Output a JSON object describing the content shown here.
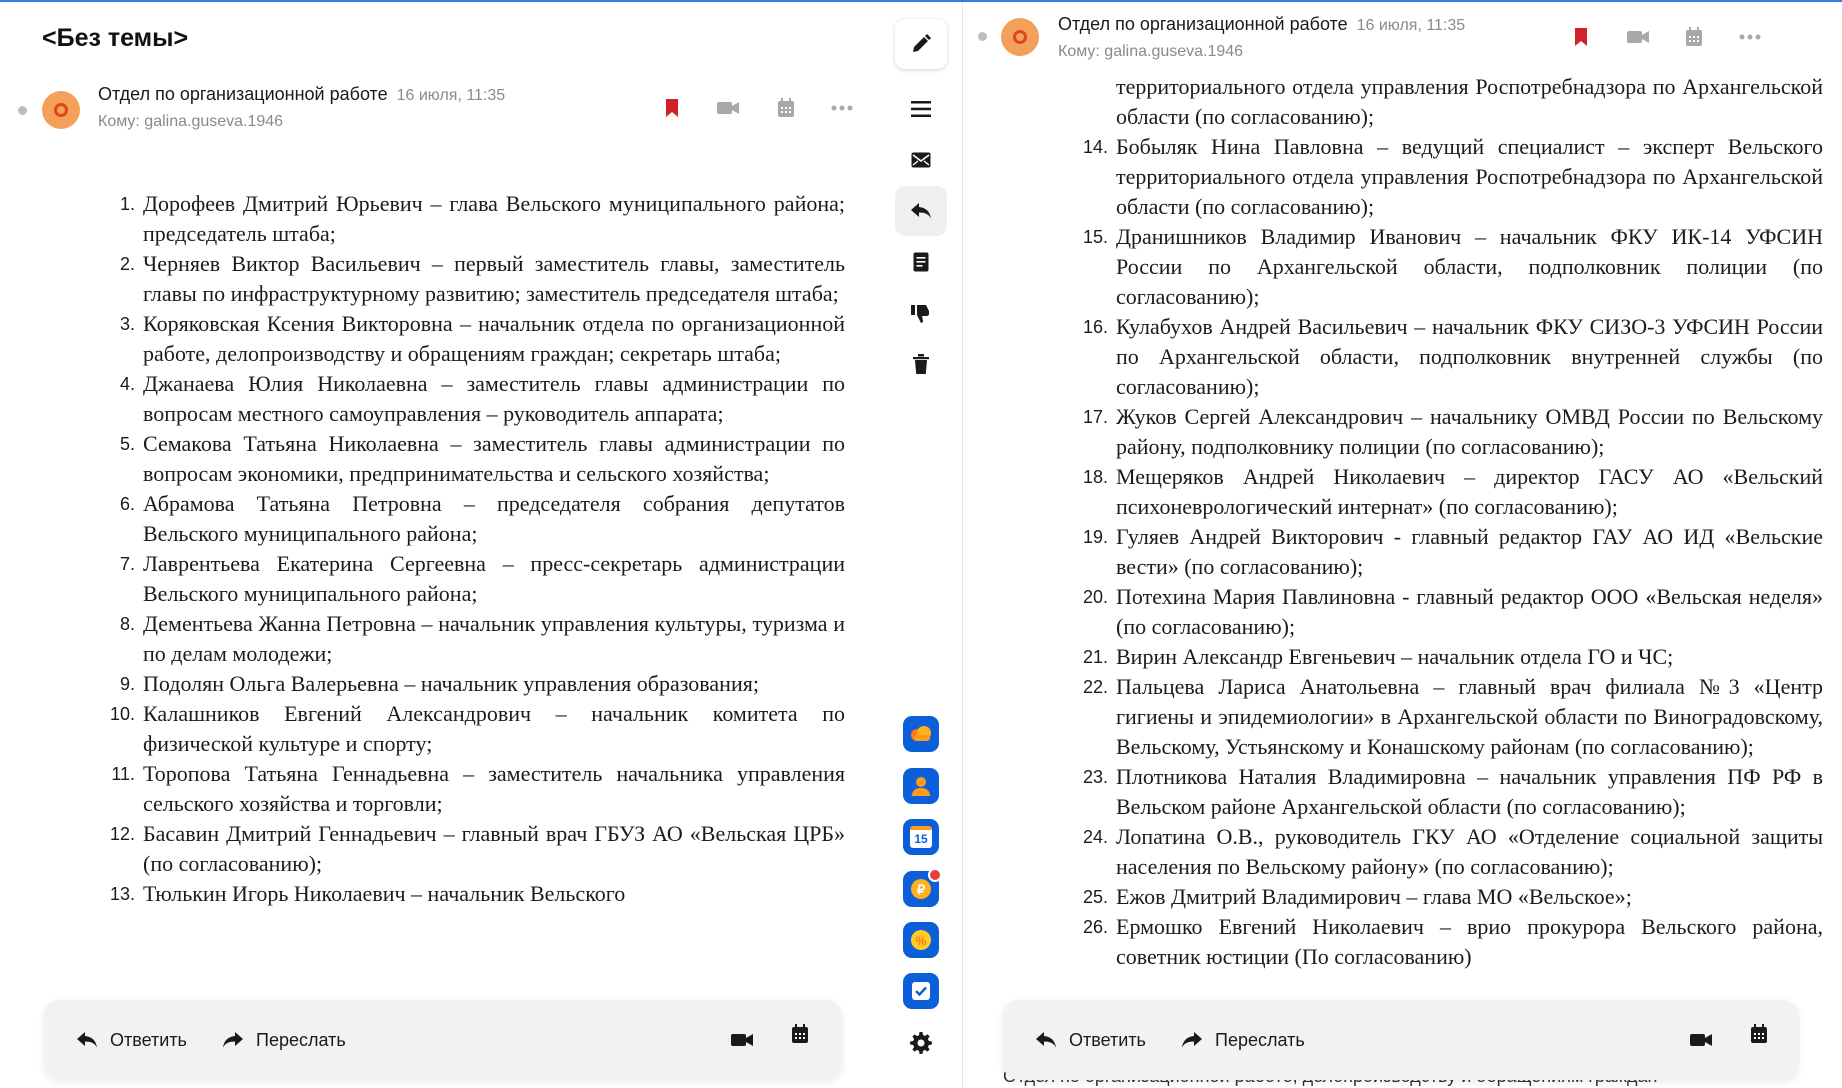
{
  "left": {
    "subject": "<Без темы>",
    "sender": "Отдел по организационной работе",
    "date": "16 июля, 11:35",
    "recipient": "Кому: galina.guseva.1946",
    "items": [
      {
        "num": "1.",
        "text": "Дорофеев Дмитрий Юрьевич – глава Вельского муниципального района; председатель штаба;"
      },
      {
        "num": "2.",
        "text": "Черняев Виктор Васильевич – первый заместитель главы, заместитель главы по инфраструктурному развитию; заместитель председателя штаба;"
      },
      {
        "num": "3.",
        "text": "Коряковская Ксения Викторовна – начальник отдела по организационной работе, делопроизводству и обращениям граждан; секретарь штаба;"
      },
      {
        "num": "4.",
        "text": "Джанаева Юлия Николаевна – заместитель главы администрации по вопросам местного самоуправления – руководитель аппарата;"
      },
      {
        "num": "5.",
        "text": "Семакова Татьяна Николаевна – заместитель главы администрации по вопросам экономики, предпринимательства и сельского хозяйства;"
      },
      {
        "num": "6.",
        "text": "Абрамова Татьяна Петровна – председателя собрания депутатов Вельского муниципального района;"
      },
      {
        "num": "7.",
        "text": "Лаврентьева Екатерина Сергеевна – пресс-секретарь администрации Вельского муниципального района;"
      },
      {
        "num": "8.",
        "text": "Дементьева Жанна Петровна – начальник управления культуры, туризма и по делам молодежи;"
      },
      {
        "num": "9.",
        "text": "Подолян Ольга Валерьевна – начальник управления образования;"
      },
      {
        "num": "10.",
        "text": "Калашников Евгений Александрович – начальник комитета по физической культуре и спорту;"
      },
      {
        "num": "11.",
        "text": "Торопова Татьяна Геннадьевна – заместитель начальника управления сельского хозяйства и торговли;"
      },
      {
        "num": "12.",
        "text": "Басавин Дмитрий Геннадьевич – главный врач ГБУЗ АО «Вельская ЦРБ» (по согласованию);"
      },
      {
        "num": "13.",
        "text": "Тюлькин Игорь Николаевич – начальник Вельского"
      }
    ],
    "reply_label": "Ответить",
    "forward_label": "Переслать"
  },
  "right": {
    "sender": "Отдел по организационной работе",
    "date": "16 июля, 11:35",
    "recipient": "Кому: galina.guseva.1946",
    "continuation": "территориального отдела управления Роспотребнадзора по Архангельской области (по согласованию);",
    "items": [
      {
        "num": "14.",
        "text": "Бобыляк Нина Павловна – ведущий специалист – эксперт Вельского территориального отдела управления Роспотребнадзора по Архангельской области (по согласованию);"
      },
      {
        "num": "15.",
        "text": "Дранишников Владимир Иванович – начальник ФКУ ИК-14 УФСИН России по Архангельской области, подполковник полиции (по согласованию);"
      },
      {
        "num": "16.",
        "text": "Кулабухов Андрей Васильевич – начальник ФКУ СИЗО-3 УФСИН России по Архангельской области, подполковник внутренней службы (по согласованию);"
      },
      {
        "num": "17.",
        "text": "Жуков Сергей Александрович – начальнику ОМВД России по Вельскому району, подполковнику полиции (по согласованию);"
      },
      {
        "num": "18.",
        "text": "Мещеряков Андрей Николаевич – директор ГАСУ АО «Вельский психоневрологический интернат» (по согласованию);"
      },
      {
        "num": "19.",
        "text": "Гуляев Андрей Викторович - главный редактор ГАУ АО ИД «Вельские вести» (по согласованию);"
      },
      {
        "num": "20.",
        "text": "Потехина Мария Павлиновна - главный редактор ООО «Вельская неделя» (по согласованию);"
      },
      {
        "num": "21.",
        "text": "Вирин Александр Евгеньевич – начальник отдела ГО и ЧС;"
      },
      {
        "num": "22.",
        "text": "Пальцева Лариса Анатольевна – главный врач филиала №3 «Центр гигиены и эпидемиологии» в Архангельской области по Виноградовскому, Вельскому, Устьянскому и Конашскому районам (по согласованию);"
      },
      {
        "num": "23.",
        "text": "Плотникова Наталия Владимировна – начальник управления ПФ РФ в Вельском районе Архангельской области (по согласованию);"
      },
      {
        "num": "24.",
        "text": "Лопатина О.В., руководитель ГКУ АО «Отделение социальной защиты населения по Вельскому району» (по согласованию);"
      },
      {
        "num": "25.",
        "text": "Ежов Дмитрий Владимирович – глава МО «Вельское»;"
      },
      {
        "num": "26.",
        "text": "Ермошко Евгений Николаевич – врио прокурора Вельского района, советник юстиции (По согласованию)"
      }
    ],
    "reply_label": "Ответить",
    "forward_label": "Переслать",
    "peek_text": "Отдел по организационной работе, делопроизводству и обращениям граждан"
  },
  "toolbar": {
    "calendar_app_day": "15"
  },
  "colors": {
    "bookmark": "#d4202c",
    "app_blue": "#0b5fd8",
    "avatar_bg": "#f5a05a",
    "avatar_ring": "#d9471b"
  }
}
